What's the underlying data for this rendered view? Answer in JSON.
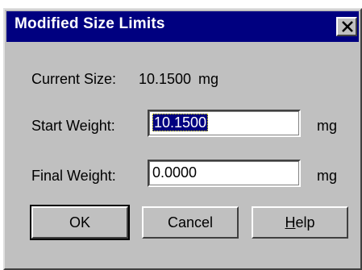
{
  "window": {
    "title": "Modified Size Limits",
    "title_color": "#000080"
  },
  "current_size": {
    "label": "Current Size:",
    "value": "10.1500",
    "unit": "mg"
  },
  "start_weight": {
    "label": "Start Weight:",
    "value": "10.1500",
    "unit": "mg"
  },
  "final_weight": {
    "label": "Final Weight:",
    "value": "0.0000",
    "unit": "mg"
  },
  "buttons": {
    "ok": "OK",
    "cancel": "Cancel",
    "help_accel": "H",
    "help_rest": "elp"
  },
  "icons": {
    "close": "close-icon"
  }
}
